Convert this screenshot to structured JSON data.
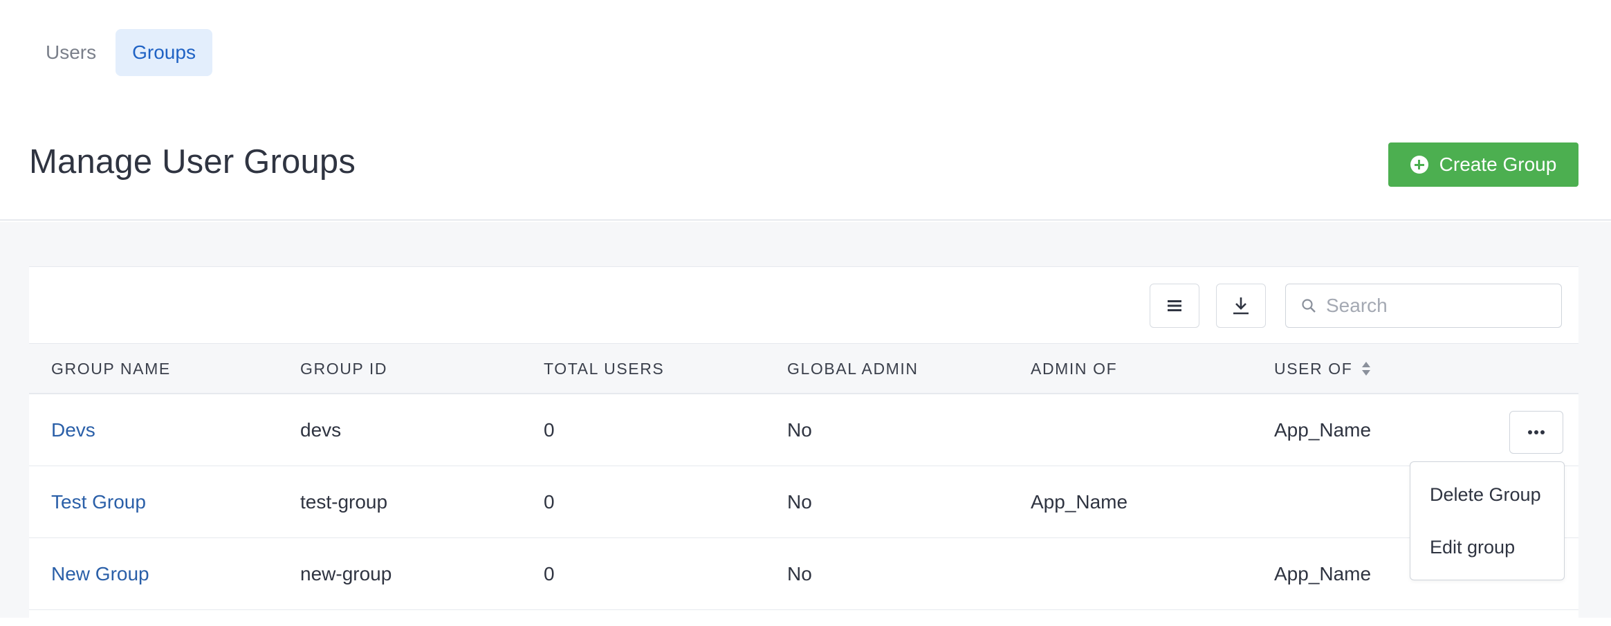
{
  "tabs": [
    {
      "label": "Users",
      "active": false
    },
    {
      "label": "Groups",
      "active": true
    }
  ],
  "page_title": "Manage User Groups",
  "create_button_label": "Create Group",
  "search": {
    "placeholder": "Search",
    "value": ""
  },
  "columns": [
    "GROUP NAME",
    "GROUP ID",
    "TOTAL USERS",
    "GLOBAL ADMIN",
    "ADMIN OF",
    "USER OF"
  ],
  "rows": [
    {
      "name": "Devs",
      "id": "devs",
      "total_users": "0",
      "global_admin": "No",
      "admin_of": "",
      "user_of": "App_Name"
    },
    {
      "name": "Test Group",
      "id": "test-group",
      "total_users": "0",
      "global_admin": "No",
      "admin_of": "App_Name",
      "user_of": ""
    },
    {
      "name": "New Group",
      "id": "new-group",
      "total_users": "0",
      "global_admin": "No",
      "admin_of": "",
      "user_of": "App_Name"
    }
  ],
  "row_menu": {
    "items": [
      "Delete Group",
      "Edit group"
    ]
  },
  "colors": {
    "accent_green": "#4caf50",
    "link_blue": "#2a5fa8",
    "active_tab_bg": "#e3eefc",
    "active_tab_text": "#1f62c4"
  },
  "icons": {
    "create": "plus-circle-icon",
    "columns": "list-icon",
    "download": "download-icon",
    "search": "search-icon",
    "sort": "sort-icon",
    "more": "more-horizontal-icon"
  }
}
